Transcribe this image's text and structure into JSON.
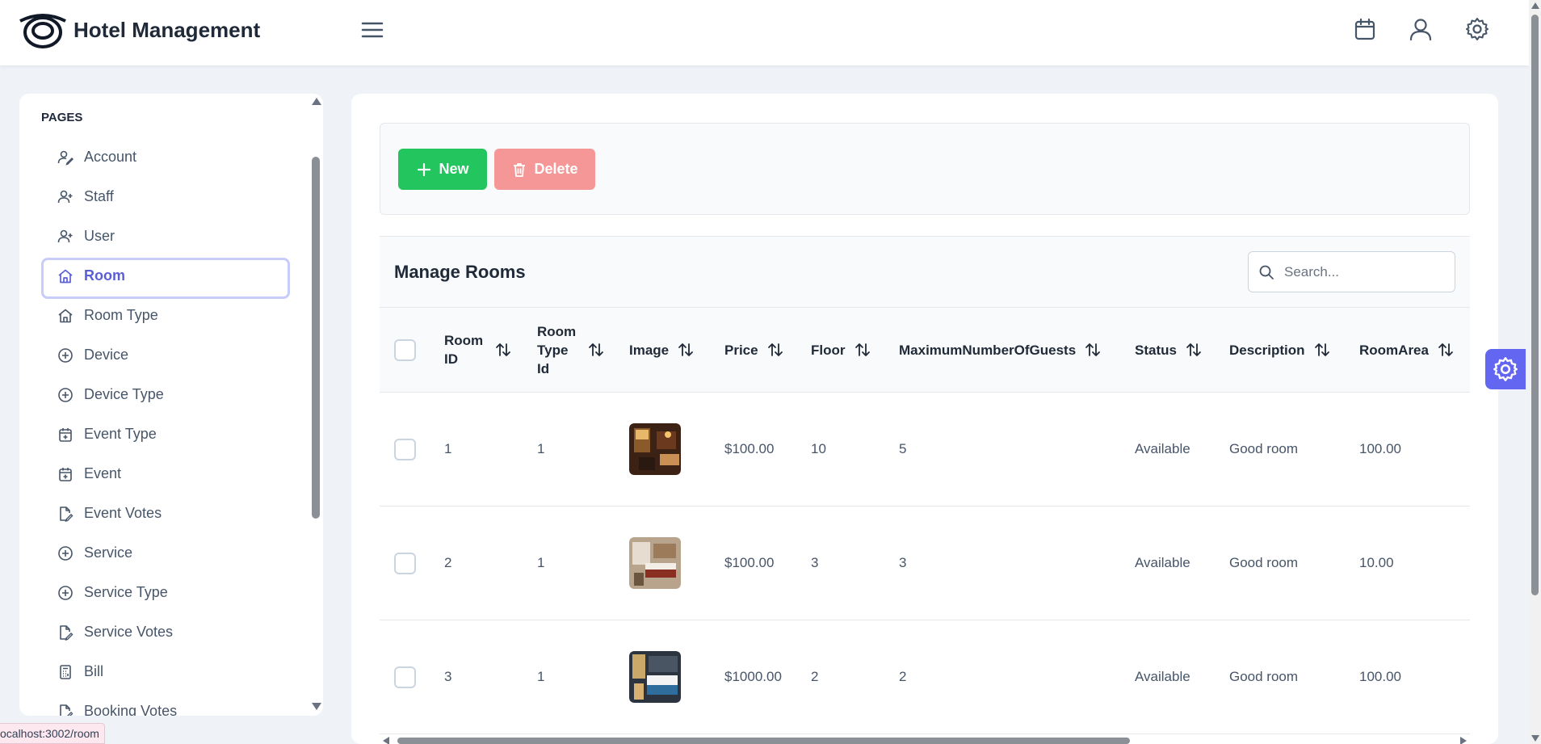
{
  "app": {
    "title": "Hotel Management"
  },
  "sidebar": {
    "section_title": "PAGES",
    "items": [
      {
        "label": "Account",
        "icon": "user-edit-icon"
      },
      {
        "label": "Staff",
        "icon": "user-plus-icon"
      },
      {
        "label": "User",
        "icon": "user-plus-icon"
      },
      {
        "label": "Room",
        "icon": "home-icon",
        "active": true
      },
      {
        "label": "Room Type",
        "icon": "home-icon"
      },
      {
        "label": "Device",
        "icon": "plus-circle-icon"
      },
      {
        "label": "Device Type",
        "icon": "plus-circle-icon"
      },
      {
        "label": "Event Type",
        "icon": "calendar-plus-icon"
      },
      {
        "label": "Event",
        "icon": "calendar-plus-icon"
      },
      {
        "label": "Event Votes",
        "icon": "file-edit-icon"
      },
      {
        "label": "Service",
        "icon": "plus-circle-icon"
      },
      {
        "label": "Service Type",
        "icon": "plus-circle-icon"
      },
      {
        "label": "Service Votes",
        "icon": "file-edit-icon"
      },
      {
        "label": "Bill",
        "icon": "calculator-icon"
      },
      {
        "label": "Booking Votes",
        "icon": "file-edit-icon"
      }
    ]
  },
  "status_url": "ocalhost:3002/room",
  "toolbar": {
    "new_label": "New",
    "delete_label": "Delete"
  },
  "table": {
    "title": "Manage Rooms",
    "search_placeholder": "Search...",
    "columns": {
      "room_id": "Room ID",
      "room_type_id": "Room Type Id",
      "image": "Image",
      "price": "Price",
      "floor": "Floor",
      "max_guests": "MaximumNumberOfGuests",
      "status": "Status",
      "description": "Description",
      "room_area": "RoomArea"
    },
    "rows": [
      {
        "room_id": "1",
        "room_type_id": "1",
        "price": "$100.00",
        "floor": "10",
        "max_guests": "5",
        "status": "Available",
        "description": "Good room",
        "room_area": "100.00"
      },
      {
        "room_id": "2",
        "room_type_id": "1",
        "price": "$100.00",
        "floor": "3",
        "max_guests": "3",
        "status": "Available",
        "description": "Good room",
        "room_area": "10.00"
      },
      {
        "room_id": "3",
        "room_type_id": "1",
        "price": "$1000.00",
        "floor": "2",
        "max_guests": "2",
        "status": "Available",
        "description": "Good room",
        "room_area": "100.00"
      }
    ]
  },
  "colors": {
    "accent": "#6366f1",
    "new_button": "#22c55e",
    "delete_button": "#f59797",
    "active_item_text": "#5b5fd6"
  }
}
